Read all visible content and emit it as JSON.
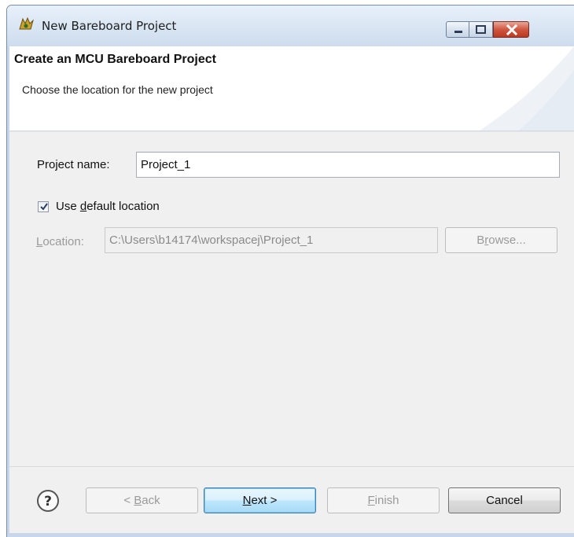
{
  "window": {
    "title": "New Bareboard Project",
    "controls": {
      "minimize": "minimize-icon",
      "maximize": "maximize-icon",
      "close": "close-icon"
    }
  },
  "header": {
    "title": "Create an MCU Bareboard Project",
    "description": "Choose the location for the new project"
  },
  "form": {
    "project_name_label": "Project name:",
    "project_name_value": "Project_1",
    "use_default": {
      "label_before": "Use ",
      "mnemonic": "d",
      "label_after": "efault location",
      "checked": true
    },
    "location": {
      "mnemonic": "L",
      "label_after": "ocation:",
      "value": "C:\\Users\\b14174\\workspacej\\Project_1",
      "enabled": false
    },
    "browse": {
      "before": "B",
      "mnemonic": "r",
      "after": "owse...",
      "enabled": false
    }
  },
  "footer": {
    "help_icon": "question-circle-icon",
    "back": {
      "before": "< ",
      "mnemonic": "B",
      "after": "ack",
      "enabled": false
    },
    "next": {
      "mnemonic": "N",
      "after": "ext >",
      "enabled": true
    },
    "finish": {
      "mnemonic": "F",
      "after": "inish",
      "enabled": false
    },
    "cancel": {
      "label": "Cancel",
      "enabled": true
    }
  }
}
